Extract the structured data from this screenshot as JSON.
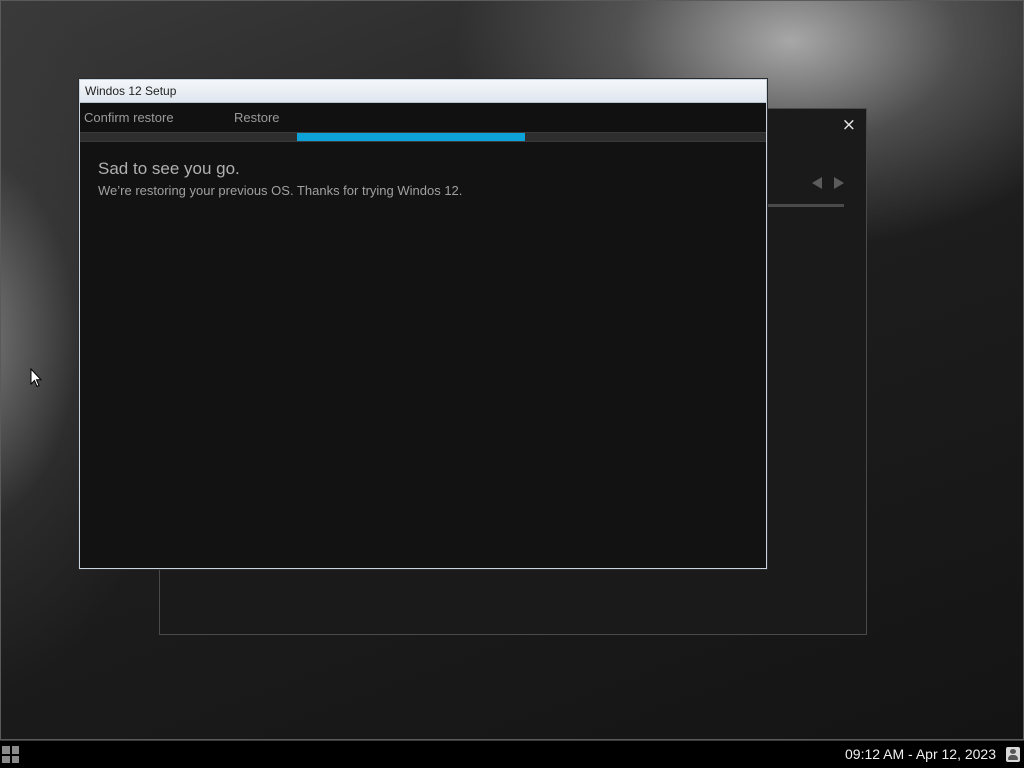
{
  "setup_window": {
    "title": "Windos 12 Setup",
    "steps": [
      {
        "label": "Confirm restore"
      },
      {
        "label": "Restore"
      }
    ],
    "progress": {
      "start_fraction": 0.316,
      "end_fraction": 0.648,
      "color": "#0ea3d8"
    },
    "heading": "Sad to see you go.",
    "message": "We’re restoring your previous OS. Thanks for trying Windos 12."
  },
  "background_window": {
    "close_symbol": "×",
    "icons": [
      "close-icon",
      "arrow-left-icon",
      "arrow-right-icon"
    ]
  },
  "taskbar": {
    "clock": "09:12 AM - Apr 12, 2023",
    "icons": [
      "start-icon",
      "user-icon"
    ]
  }
}
